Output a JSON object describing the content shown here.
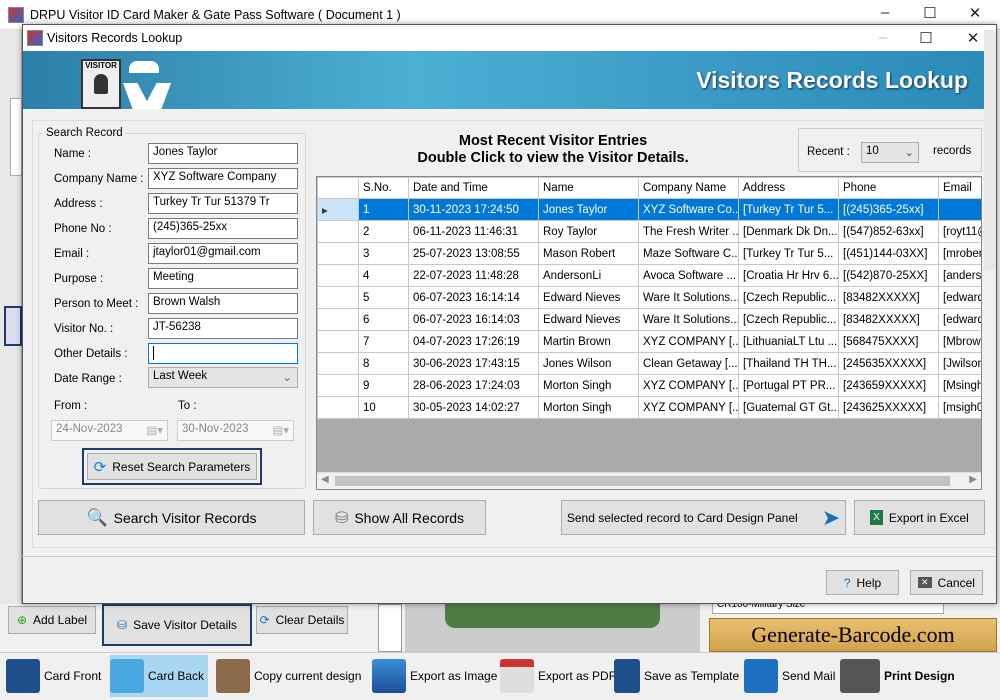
{
  "app": {
    "title": "DRPU Visitor ID Card Maker & Gate Pass Software ( Document 1 )"
  },
  "dialog": {
    "title": "Visitors Records Lookup",
    "banner_title": "Visitors Records Lookup",
    "badge_text": "VISITOR"
  },
  "search": {
    "group_label": "Search Record",
    "fields": [
      {
        "label": "Name :",
        "value": "Jones Taylor"
      },
      {
        "label": "Company Name :",
        "value": "XYZ Software Company"
      },
      {
        "label": "Address :",
        "value": "Turkey Tr Tur 51379 Tr"
      },
      {
        "label": "Phone No :",
        "value": "(245)365-25xx"
      },
      {
        "label": "Email :",
        "value": "jtaylor01@gmail.com"
      },
      {
        "label": "Purpose :",
        "value": "Meeting"
      },
      {
        "label": "Person to Meet :",
        "value": "Brown Walsh"
      },
      {
        "label": "Visitor No. :",
        "value": "JT-56238"
      },
      {
        "label": "Other Details :",
        "value": ""
      }
    ],
    "date_range_label": "Date Range :",
    "date_range_value": "Last Week",
    "from_label": "From :",
    "from_value": "24-Nov-2023",
    "to_label": "To :",
    "to_value": "30-Nov-2023",
    "reset_label": "Reset Search Parameters"
  },
  "recent": {
    "heading1": "Most Recent Visitor Entries",
    "heading2": "Double Click to view the Visitor Details.",
    "recent_label": "Recent :",
    "recent_value": "10",
    "records_label": "records"
  },
  "table": {
    "columns": [
      "S.No.",
      "Date and Time",
      "Name",
      "Company Name",
      "Address",
      "Phone",
      "Email"
    ],
    "rows": [
      [
        "1",
        "30-11-2023 17:24:50",
        "Jones Taylor",
        "XYZ Software Co...",
        "[Turkey Tr Tur 5...",
        "[(245)365-25xx]",
        ""
      ],
      [
        "2",
        "06-11-2023 11:46:31",
        "Roy Taylor",
        "The Fresh Writer ...",
        "[Denmark Dk Dn...",
        "[(547)852-63xx]",
        "[royt11@"
      ],
      [
        "3",
        "25-07-2023 13:08:55",
        "Mason Robert",
        "Maze Software C...",
        "[Turkey Tr Tur 5...",
        "[(451)144-03XX]",
        "[mrobert"
      ],
      [
        "4",
        "22-07-2023 11:48:28",
        "AndersonLi",
        "Avoca Software ...",
        "[Croatia Hr Hrv 6...",
        "[(542)870-25XX]",
        "[anderso"
      ],
      [
        "5",
        "06-07-2023 16:14:14",
        "Edward Nieves",
        "Ware It Solutions...",
        "[Czech Republic...",
        "[83482XXXXX]",
        "[edward"
      ],
      [
        "6",
        "06-07-2023 16:14:03",
        "Edward Nieves",
        "Ware It Solutions...",
        "[Czech Republic...",
        "[83482XXXXX]",
        "[edward"
      ],
      [
        "7",
        "04-07-2023 17:26:19",
        "Martin Brown",
        "XYZ COMPANY [...",
        "[LithuaniaLT Ltu ...",
        "[568475XXXX]",
        "[Mbrown"
      ],
      [
        "8",
        "30-06-2023 17:43:15",
        "Jones Wilson",
        "Clean Getaway [...",
        "[Thailand TH TH...",
        "[245635XXXXX]",
        "[Jwilson"
      ],
      [
        "9",
        "28-06-2023 17:24:03",
        "Morton Singh",
        "XYZ COMPANY [...",
        "[Portugal PT PR...",
        "[243659XXXXX]",
        "[Msingh"
      ],
      [
        "10",
        "30-05-2023 14:02:27",
        "Morton Singh",
        "XYZ COMPANY [...",
        "[Guatemal GT Gt...",
        "[243625XXXXX]",
        "[msigh0"
      ]
    ]
  },
  "buttons": {
    "search": "Search Visitor Records",
    "show_all": "Show All Records",
    "send": "Send selected record to Card Design Panel",
    "export": "Export in Excel",
    "help": "Help",
    "cancel": "Cancel"
  },
  "background": {
    "add_label": "Add Label",
    "save_visitor": "Save Visitor Details",
    "clear_details": "Clear Details",
    "size_value": "CR100-Military Size",
    "brand": "Generate-Barcode.com"
  },
  "toolbar": [
    "Card Front",
    "Card Back",
    "Copy current design",
    "Export as Image",
    "Export as PDF",
    "Save as Template",
    "Send Mail",
    "Print Design"
  ]
}
